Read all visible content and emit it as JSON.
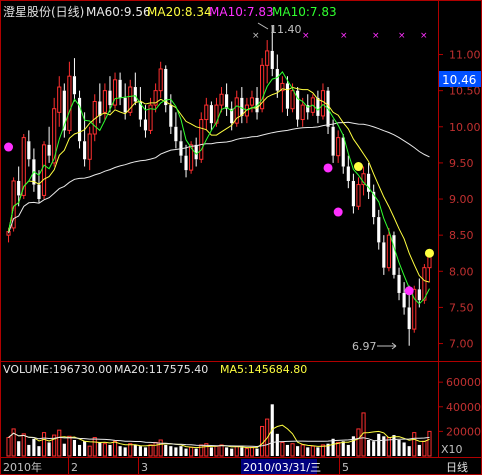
{
  "header": {
    "stock": "澄星股份(日线)",
    "ma60": "MA60:9.56",
    "ma20": "MA20:8.34",
    "ma10a": "MA10:7.83",
    "ma10b": "MA10:7.83"
  },
  "volume_header": {
    "volume": "VOLUME:196730.00",
    "ma20": "MA20:117575.40",
    "ma5": "MA5:145684.80"
  },
  "bottom_axis": {
    "labels": [
      "2010年",
      "2",
      "3",
      "2010/03/31/三",
      "5"
    ],
    "period_button": "日线"
  },
  "volume_unit": "X10",
  "colors": {
    "up": "#ff3030",
    "down": "#ffffff",
    "ma_white": "#e8e8e8",
    "ma_yellow": "#ffff40",
    "ma_green": "#30ff30",
    "ma_magenta": "#ff30ff",
    "axis": "#b00000",
    "price_tag": "#0050ff"
  },
  "chart_data": {
    "type": "candlestick",
    "ylim": [
      6.8,
      11.45
    ],
    "yticks": [
      "11.00",
      "10.50",
      "10.00",
      "9.50",
      "9.00",
      "8.50",
      "8.00",
      "7.50",
      "7.00"
    ],
    "current_price": "10.46",
    "annotations": {
      "high": "11.40",
      "low": "6.97"
    },
    "candles": [
      [
        8.5,
        8.6,
        8.4,
        8.55
      ],
      [
        8.6,
        9.3,
        8.55,
        9.25
      ],
      [
        9.25,
        9.45,
        8.9,
        9.05
      ],
      [
        9.05,
        9.9,
        9.0,
        9.85
      ],
      [
        9.8,
        9.95,
        9.45,
        9.55
      ],
      [
        9.55,
        9.7,
        9.1,
        9.2
      ],
      [
        9.2,
        9.4,
        8.95,
        9.0
      ],
      [
        9.05,
        9.8,
        9.0,
        9.75
      ],
      [
        9.75,
        10.0,
        9.5,
        9.6
      ],
      [
        9.5,
        10.4,
        9.45,
        10.25
      ],
      [
        10.2,
        10.7,
        10.0,
        10.55
      ],
      [
        10.5,
        10.6,
        9.85,
        9.95
      ],
      [
        9.95,
        10.9,
        9.9,
        10.7
      ],
      [
        10.7,
        10.95,
        10.35,
        10.45
      ],
      [
        10.4,
        10.5,
        9.7,
        9.8
      ],
      [
        9.8,
        10.2,
        9.45,
        9.55
      ],
      [
        9.55,
        10.0,
        9.4,
        9.9
      ],
      [
        9.9,
        10.45,
        9.8,
        10.35
      ],
      [
        10.35,
        10.6,
        10.05,
        10.15
      ],
      [
        10.2,
        10.6,
        10.1,
        10.5
      ],
      [
        10.5,
        10.7,
        10.2,
        10.3
      ],
      [
        10.3,
        10.75,
        10.25,
        10.65
      ],
      [
        10.65,
        10.75,
        10.3,
        10.4
      ],
      [
        10.4,
        10.6,
        10.1,
        10.2
      ],
      [
        10.2,
        10.65,
        10.15,
        10.55
      ],
      [
        10.55,
        10.75,
        10.3,
        10.35
      ],
      [
        10.35,
        10.55,
        10.0,
        10.1
      ],
      [
        10.1,
        10.3,
        9.85,
        9.95
      ],
      [
        9.95,
        10.4,
        9.9,
        10.3
      ],
      [
        10.3,
        10.6,
        10.2,
        10.5
      ],
      [
        10.5,
        10.9,
        10.4,
        10.8
      ],
      [
        10.8,
        10.85,
        10.2,
        10.3
      ],
      [
        10.3,
        10.45,
        9.9,
        10.0
      ],
      [
        10.0,
        10.2,
        9.7,
        9.8
      ],
      [
        9.8,
        9.95,
        9.5,
        9.6
      ],
      [
        9.6,
        9.75,
        9.3,
        9.4
      ],
      [
        9.4,
        9.8,
        9.35,
        9.75
      ],
      [
        9.75,
        9.85,
        9.45,
        9.55
      ],
      [
        9.55,
        10.2,
        9.5,
        10.1
      ],
      [
        10.1,
        10.4,
        9.95,
        10.3
      ],
      [
        10.3,
        10.35,
        9.95,
        10.05
      ],
      [
        10.05,
        10.4,
        10.0,
        10.3
      ],
      [
        10.3,
        10.55,
        10.2,
        10.45
      ],
      [
        10.45,
        10.6,
        10.15,
        10.25
      ],
      [
        10.25,
        10.35,
        9.95,
        10.05
      ],
      [
        10.05,
        10.5,
        10.0,
        10.4
      ],
      [
        10.4,
        10.55,
        10.05,
        10.15
      ],
      [
        10.15,
        10.4,
        10.05,
        10.3
      ],
      [
        10.3,
        10.5,
        10.2,
        10.4
      ],
      [
        10.4,
        10.55,
        10.1,
        10.2
      ],
      [
        10.25,
        10.95,
        10.2,
        10.85
      ],
      [
        10.85,
        11.2,
        10.6,
        11.05
      ],
      [
        11.05,
        11.4,
        10.7,
        10.8
      ],
      [
        10.8,
        11.0,
        10.4,
        10.5
      ],
      [
        10.5,
        10.7,
        10.2,
        10.6
      ],
      [
        10.6,
        10.7,
        10.15,
        10.25
      ],
      [
        10.25,
        10.6,
        10.2,
        10.5
      ],
      [
        10.5,
        10.55,
        10.0,
        10.1
      ],
      [
        10.1,
        10.4,
        10.0,
        10.3
      ],
      [
        10.3,
        10.45,
        10.1,
        10.2
      ],
      [
        10.2,
        10.45,
        10.15,
        10.4
      ],
      [
        10.4,
        10.5,
        10.05,
        10.15
      ],
      [
        10.15,
        10.6,
        10.1,
        10.5
      ],
      [
        10.5,
        10.55,
        9.9,
        10.0
      ],
      [
        10.0,
        10.1,
        9.5,
        9.6
      ],
      [
        9.6,
        9.95,
        9.5,
        9.85
      ],
      [
        9.85,
        9.9,
        9.35,
        9.45
      ],
      [
        9.45,
        9.6,
        9.15,
        9.25
      ],
      [
        9.25,
        9.35,
        8.8,
        8.9
      ],
      [
        8.9,
        9.3,
        8.85,
        9.2
      ],
      [
        9.2,
        9.45,
        9.05,
        9.35
      ],
      [
        9.35,
        9.5,
        9.0,
        9.1
      ],
      [
        9.1,
        9.2,
        8.65,
        8.75
      ],
      [
        8.75,
        8.85,
        8.3,
        8.4
      ],
      [
        8.4,
        8.5,
        7.95,
        8.05
      ],
      [
        8.05,
        8.6,
        8.0,
        8.5
      ],
      [
        8.5,
        8.55,
        7.9,
        7.95
      ],
      [
        7.95,
        8.05,
        7.6,
        7.7
      ],
      [
        7.7,
        7.85,
        7.4,
        7.5
      ],
      [
        7.5,
        7.8,
        6.97,
        7.2
      ],
      [
        7.2,
        7.8,
        7.15,
        7.75
      ],
      [
        7.75,
        7.9,
        7.5,
        7.6
      ],
      [
        7.6,
        8.1,
        7.55,
        8.05
      ],
      [
        8.05,
        8.3,
        7.85,
        8.2
      ]
    ],
    "dots": [
      {
        "i": 0,
        "price": 9.72,
        "color": "magenta"
      },
      {
        "i": 63,
        "price": 9.43,
        "color": "magenta"
      },
      {
        "i": 65,
        "price": 8.82,
        "color": "magenta"
      },
      {
        "i": 69,
        "price": 9.45,
        "color": "yellow"
      },
      {
        "i": 79,
        "price": 7.73,
        "color": "magenta"
      },
      {
        "i": 83,
        "price": 8.25,
        "color": "yellow"
      }
    ],
    "volume": {
      "ylim": [
        0,
        65000
      ],
      "yticks": [
        "60000",
        "40000",
        "20000"
      ],
      "values": [
        15000,
        22000,
        12000,
        18000,
        9000,
        14000,
        8000,
        19000,
        11000,
        17000,
        21000,
        10000,
        16000,
        13000,
        9000,
        12000,
        8000,
        15000,
        11000,
        10000,
        9000,
        12000,
        8000,
        7000,
        10000,
        9000,
        8000,
        7000,
        9000,
        11000,
        13000,
        9000,
        8000,
        7000,
        8000,
        6000,
        7000,
        6000,
        9000,
        10000,
        7000,
        8000,
        9000,
        7000,
        6000,
        8000,
        7000,
        6000,
        7000,
        6000,
        24000,
        30000,
        42000,
        18000,
        11000,
        9000,
        10000,
        8000,
        9000,
        7000,
        8000,
        7000,
        9000,
        10000,
        14000,
        11000,
        12000,
        9000,
        16000,
        22000,
        35000,
        13000,
        12000,
        18000,
        16000,
        15000,
        17000,
        13000,
        11000,
        8000,
        19000,
        9000,
        12000,
        20000
      ]
    }
  }
}
